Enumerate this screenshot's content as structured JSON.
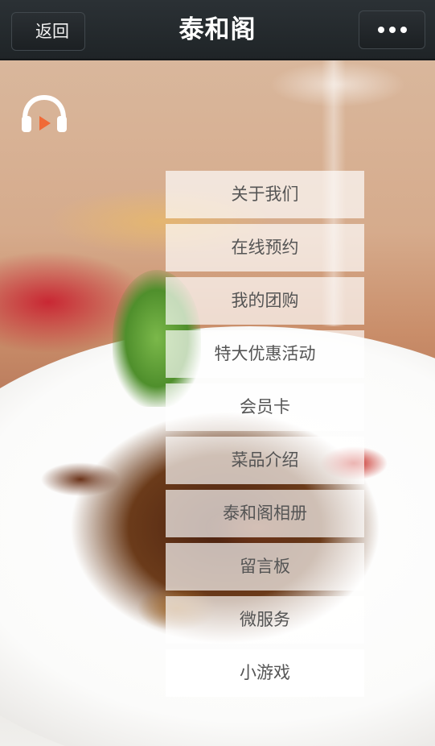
{
  "header": {
    "back_label": "返回",
    "title": "泰和阁",
    "more_icon": "more-dots-icon"
  },
  "music_icon": "headphones-icon",
  "menu": {
    "items": [
      {
        "label": "关于我们"
      },
      {
        "label": "在线预约"
      },
      {
        "label": "我的团购"
      },
      {
        "label": "特大优惠活动"
      },
      {
        "label": "会员卡"
      },
      {
        "label": "菜品介绍"
      },
      {
        "label": "泰和阁相册"
      },
      {
        "label": "留言板"
      },
      {
        "label": "微服务"
      },
      {
        "label": "小游戏"
      }
    ]
  },
  "colors": {
    "topbar": "#22282b",
    "accent_orange": "#f06a36",
    "menu_text": "#555555"
  }
}
